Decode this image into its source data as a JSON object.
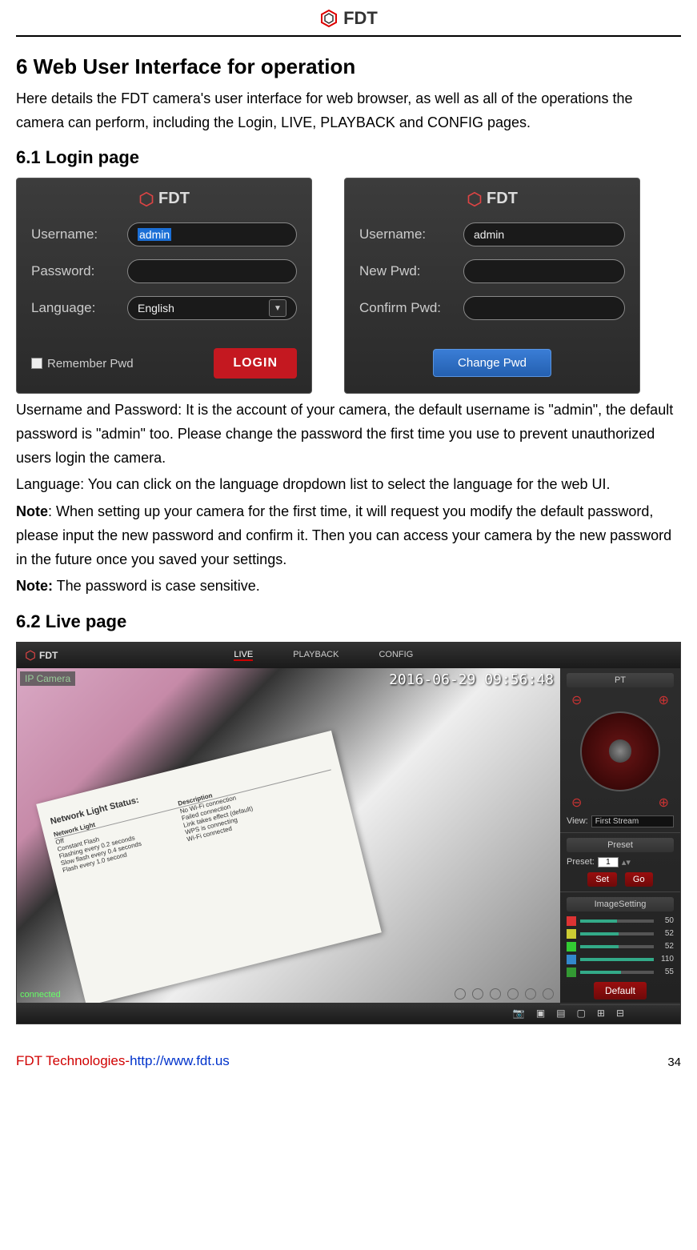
{
  "header": {
    "brand": "FDT"
  },
  "section": {
    "title": "6 Web User Interface for operation",
    "intro": "Here details the FDT camera's user interface for web browser, as well as all of the operations the camera can perform, including the Login, LIVE, PLAYBACK and CONFIG pages."
  },
  "login": {
    "heading": "6.1 Login page",
    "panel1": {
      "brand": "FDT",
      "username_label": "Username:",
      "username_value": "admin",
      "password_label": "Password:",
      "language_label": "Language:",
      "language_value": "English",
      "remember_label": "Remember Pwd",
      "login_btn": "LOGIN"
    },
    "panel2": {
      "brand": "FDT",
      "username_label": "Username:",
      "username_value": "admin",
      "newpwd_label": "New Pwd:",
      "confirm_label": "Confirm Pwd:",
      "change_btn": "Change Pwd"
    },
    "text1": "Username and Password: It is the account of your camera, the default username is \"admin\", the default password is \"admin\" too. Please change the password the first time you use to prevent unauthorized users login the camera.",
    "text2": "Language: You can click on the language dropdown list to select the language for the web UI.",
    "note1_label": "Note",
    "note1_text": ": When setting up your camera for the first time, it will request you modify the default password, please input the new password and confirm it. Then you can access your camera by the new password in the future once you saved your settings.",
    "note2_label": "Note:",
    "note2_text": " The password is case sensitive."
  },
  "live": {
    "heading": "6.2 Live page",
    "brand": "FDT",
    "tabs": {
      "live": "LIVE",
      "playback": "PLAYBACK",
      "config": "CONFIG"
    },
    "ip_label": "IP Camera",
    "timestamp": "2016-06-29 09:56:48",
    "paper_title": "Network Light Status:",
    "paper_head1": "Network Light",
    "paper_head2": "Description",
    "paper_r1a": "Off",
    "paper_r1b": "No Wi-Fi connection",
    "paper_r2a": "Constant Flash",
    "paper_r2b": "Failed connection",
    "paper_r3a": "Flashing every 0.2 seconds",
    "paper_r3b": "Link takes effect (default)",
    "paper_r4a": "Slow flash every 0.4 seconds",
    "paper_r4b": "WPS is connecting",
    "paper_r5a": "Flash every 1.0 second",
    "paper_r5b": "Wi-Fi connected",
    "connected": "connected",
    "side": {
      "pt": "PT",
      "view_label": "View:",
      "view_value": "First Stream",
      "preset_title": "Preset",
      "preset_label": "Preset:",
      "preset_value": "1",
      "set_btn": "Set",
      "go_btn": "Go",
      "image_title": "ImageSetting",
      "sliders": [
        {
          "color": "#d33",
          "val": "50"
        },
        {
          "color": "#cc3",
          "val": "52"
        },
        {
          "color": "#3c3",
          "val": "52"
        },
        {
          "color": "#38c",
          "val": "110"
        },
        {
          "color": "#393",
          "val": "55"
        }
      ],
      "default_btn": "Default"
    }
  },
  "footer": {
    "company": "FDT Technologies-",
    "url": "http://www.fdt.us",
    "page": "34"
  }
}
